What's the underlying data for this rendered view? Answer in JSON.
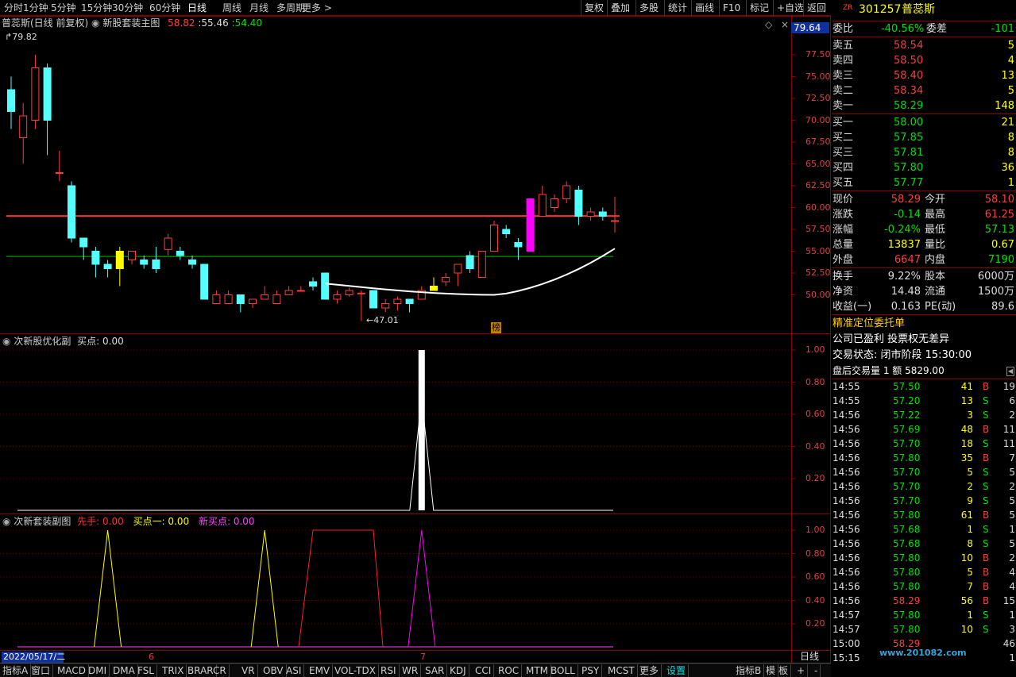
{
  "colors": {
    "up": "#ff3c3c",
    "down": "#54ffff",
    "magenta": "#ff00ff",
    "yellow": "#ffff00",
    "white": "#ffffff",
    "green": "#00e000",
    "grid": "#7a0000"
  },
  "top_tabs": [
    "分时",
    "1分钟",
    "5分钟",
    "15分钟",
    "30分钟",
    "60分钟",
    "日线",
    "周线",
    "月线",
    "多周期",
    "更多 >"
  ],
  "active_tab": "日线",
  "top_buttons": [
    "复权",
    "叠加",
    "多股",
    "统计",
    "画线",
    "F10",
    "标记",
    "+自选",
    "返回"
  ],
  "main_panel": {
    "stock_label": "普蕊斯(日线 前复权)",
    "indicator": "新股套装主图",
    "v1": "58.82",
    "v2": "55.46",
    "v3": "54.40",
    "high_marker": "79.82",
    "low_marker": "47.01",
    "bang_label": "榜",
    "current_price_tag": "79.64"
  },
  "main_axis": [
    "77.50",
    "75.00",
    "72.50",
    "70.00",
    "67.50",
    "65.00",
    "62.50",
    "60.00",
    "57.50",
    "55.00",
    "52.50",
    "50.00"
  ],
  "sub1": {
    "title": "次新股优化副",
    "buy_label": "买点: 0.00",
    "axis": [
      "1.00",
      "0.80",
      "0.60",
      "0.40",
      "0.20"
    ]
  },
  "sub2": {
    "title": "次新套装副图",
    "xianshou": "先手: 0.00",
    "maidian1": "买点一: 0.00",
    "xinmaidian": "新买点: 0.00",
    "axis": [
      "1.00",
      "0.80",
      "0.60",
      "0.40",
      "0.20"
    ]
  },
  "date_row": {
    "date": "2022/05/17/二",
    "m6": "6",
    "m7": "7",
    "rizhou": "日线"
  },
  "bottom_tabs": [
    "指标A",
    "窗口",
    "MACD",
    "DMI",
    "DMA",
    "FSL",
    "TRIX",
    "BRAR",
    "CR",
    "VR",
    "OBV",
    "ASI",
    "EMV",
    "VOL-TDX",
    "RSI",
    "WR",
    "SAR",
    "KDJ",
    "CCI",
    "ROC",
    "MTM",
    "BOLL",
    "PSY",
    "MCST",
    "更多",
    "设置"
  ],
  "bottom_right": [
    "指标B",
    "模",
    "板",
    "+",
    "-"
  ],
  "quote": {
    "prefix": "ZR",
    "code": "301257",
    "name": "普蕊斯",
    "weibi_label": "委比",
    "weibi": "-40.56%",
    "weicha_label": "委差",
    "weicha": "-101",
    "sell": [
      {
        "l": "卖五",
        "p": "58.54",
        "v": "5"
      },
      {
        "l": "卖四",
        "p": "58.50",
        "v": "4"
      },
      {
        "l": "卖三",
        "p": "58.40",
        "v": "13"
      },
      {
        "l": "卖二",
        "p": "58.34",
        "v": "5"
      },
      {
        "l": "卖一",
        "p": "58.29",
        "v": "148"
      }
    ],
    "buy": [
      {
        "l": "买一",
        "p": "58.00",
        "v": "21"
      },
      {
        "l": "买二",
        "p": "57.85",
        "v": "8"
      },
      {
        "l": "买三",
        "p": "57.81",
        "v": "8"
      },
      {
        "l": "买四",
        "p": "57.80",
        "v": "36"
      },
      {
        "l": "买五",
        "p": "57.77",
        "v": "1"
      }
    ],
    "stats": [
      {
        "a": "现价",
        "av": "58.29",
        "b": "今开",
        "bv": "58.10",
        "ac": "#ff3c3c",
        "bc": "#ff3c3c"
      },
      {
        "a": "涨跌",
        "av": "-0.14",
        "b": "最高",
        "bv": "61.25",
        "ac": "#00e000",
        "bc": "#ff3c3c"
      },
      {
        "a": "涨幅",
        "av": "-0.24%",
        "b": "最低",
        "bv": "57.13",
        "ac": "#00e000",
        "bc": "#00e000"
      },
      {
        "a": "总量",
        "av": "13837",
        "b": "量比",
        "bv": "0.67",
        "ac": "#ffff00",
        "bc": "#ffff00"
      },
      {
        "a": "外盘",
        "av": "6647",
        "b": "内盘",
        "bv": "7190",
        "ac": "#ff3c3c",
        "bc": "#00e000"
      }
    ],
    "stats2": [
      {
        "a": "换手",
        "av": "9.22%",
        "b": "股本",
        "bv": "6000万"
      },
      {
        "a": "净资",
        "av": "14.48",
        "b": "流通",
        "bv": "1500万"
      },
      {
        "a": "收益(一)",
        "av": "0.163",
        "b": "PE(动)",
        "bv": "89.6"
      }
    ],
    "info": [
      "精准定位委托单",
      "公司已盈利 投票权无差异",
      "交易状态: 闭市阶段 15:30:00",
      "盘后交易量 1 额 5829.00"
    ],
    "ticks": [
      {
        "t": "14:55",
        "p": "57.50",
        "v": "41",
        "s": "B",
        "n": "19"
      },
      {
        "t": "14:55",
        "p": "57.20",
        "v": "13",
        "s": "S",
        "n": "6"
      },
      {
        "t": "14:56",
        "p": "57.22",
        "v": "3",
        "s": "S",
        "n": "2"
      },
      {
        "t": "14:56",
        "p": "57.69",
        "v": "48",
        "s": "B",
        "n": "11"
      },
      {
        "t": "14:56",
        "p": "57.70",
        "v": "18",
        "s": "S",
        "n": "11"
      },
      {
        "t": "14:56",
        "p": "57.80",
        "v": "35",
        "s": "B",
        "n": "7"
      },
      {
        "t": "14:56",
        "p": "57.70",
        "v": "5",
        "s": "S",
        "n": "5"
      },
      {
        "t": "14:56",
        "p": "57.70",
        "v": "2",
        "s": "S",
        "n": "2"
      },
      {
        "t": "14:56",
        "p": "57.70",
        "v": "9",
        "s": "S",
        "n": "5"
      },
      {
        "t": "14:56",
        "p": "57.80",
        "v": "61",
        "s": "B",
        "n": "5"
      },
      {
        "t": "14:56",
        "p": "57.68",
        "v": "1",
        "s": "S",
        "n": "1"
      },
      {
        "t": "14:56",
        "p": "57.68",
        "v": "8",
        "s": "S",
        "n": "5"
      },
      {
        "t": "14:56",
        "p": "57.80",
        "v": "10",
        "s": "B",
        "n": "2"
      },
      {
        "t": "14:56",
        "p": "57.80",
        "v": "5",
        "s": "B",
        "n": "4"
      },
      {
        "t": "14:56",
        "p": "57.80",
        "v": "7",
        "s": "B",
        "n": "4"
      },
      {
        "t": "14:56",
        "p": "58.29",
        "v": "56",
        "s": "B",
        "n": "15"
      },
      {
        "t": "14:57",
        "p": "57.80",
        "v": "1",
        "s": "S",
        "n": "1"
      },
      {
        "t": "14:57",
        "p": "57.80",
        "v": "10",
        "s": "S",
        "n": "3"
      },
      {
        "t": "15:00",
        "p": "58.29",
        "v": "",
        "s": "",
        "n": "46"
      },
      {
        "t": "15:15",
        "p": "",
        "v": "",
        "s": "",
        "n": "1"
      }
    ],
    "watermark": "www.201082.com"
  },
  "chart_data": {
    "type": "candlestick",
    "ylim": [
      47,
      80
    ],
    "candles": [
      [
        73.5,
        71,
        75,
        69
      ],
      [
        68,
        70.5,
        72,
        65
      ],
      [
        70,
        76,
        77.5,
        69
      ],
      [
        76,
        70,
        76.5,
        66
      ],
      [
        64,
        64,
        66.5,
        63
      ],
      [
        62.5,
        56.5,
        63,
        56
      ],
      [
        56.5,
        55.5,
        56.5,
        54
      ],
      [
        55,
        53.5,
        55.5,
        52
      ],
      [
        53.5,
        53,
        54,
        52
      ],
      [
        55,
        53,
        55.5,
        51
      ],
      [
        54,
        55,
        55,
        53.5
      ],
      [
        54,
        53.5,
        54.5,
        53
      ],
      [
        54,
        53,
        55.5,
        52.5
      ],
      [
        55.2,
        56.5,
        57,
        54.5
      ],
      [
        55,
        54.5,
        55.5,
        54
      ],
      [
        54,
        53.5,
        54.5,
        53
      ],
      [
        53.5,
        49.5,
        53.5,
        49.5
      ],
      [
        49,
        50,
        50.5,
        49
      ],
      [
        49,
        50,
        50.5,
        49
      ],
      [
        50,
        49,
        50,
        48
      ],
      [
        49,
        49.5,
        49.5,
        48.5
      ],
      [
        49.5,
        50,
        51,
        49.5
      ],
      [
        49,
        50,
        50.5,
        49
      ],
      [
        50,
        50.5,
        51,
        50
      ],
      [
        50.5,
        50.5,
        51,
        50.5
      ],
      [
        51.5,
        51,
        52,
        50.5
      ],
      [
        52.5,
        49.5,
        52,
        49.5
      ],
      [
        49.5,
        50,
        50.5,
        49
      ],
      [
        50,
        50.5,
        50.8,
        49.8
      ],
      [
        50.2,
        50.2,
        50.5,
        47.01
      ],
      [
        50.5,
        48.5,
        50.5,
        48.5
      ],
      [
        48.5,
        49,
        49.5,
        48
      ],
      [
        49,
        49.5,
        49.8,
        48.2
      ],
      [
        49.5,
        49,
        49.5,
        48
      ],
      [
        49.5,
        50.5,
        51,
        49.5
      ],
      [
        50.5,
        51,
        52,
        50.5
      ],
      [
        51.5,
        52,
        52.5,
        51
      ],
      [
        52.5,
        53.5,
        53.5,
        51
      ],
      [
        54.5,
        53,
        55,
        52.5
      ],
      [
        52,
        55,
        55,
        52
      ],
      [
        55,
        58,
        58.5,
        55
      ],
      [
        57.5,
        57,
        58,
        56.5
      ],
      [
        56,
        55.5,
        56.5,
        54
      ],
      [
        55,
        61,
        61,
        55
      ],
      [
        59,
        61.5,
        62.5,
        59
      ],
      [
        60,
        61,
        61.5,
        59.5
      ],
      [
        61,
        62.5,
        63,
        60.5
      ],
      [
        62,
        59,
        62.5,
        58
      ],
      [
        59,
        59.5,
        60,
        58.5
      ],
      [
        59.5,
        59,
        60,
        58.5
      ],
      [
        58.5,
        58.5,
        61.25,
        57.13
      ]
    ],
    "xian_shou_peaks": [
      8,
      21
    ],
    "new_buy_peak": 34,
    "maidian1_plateau": [
      25,
      30
    ],
    "sub1_peak": 34
  }
}
